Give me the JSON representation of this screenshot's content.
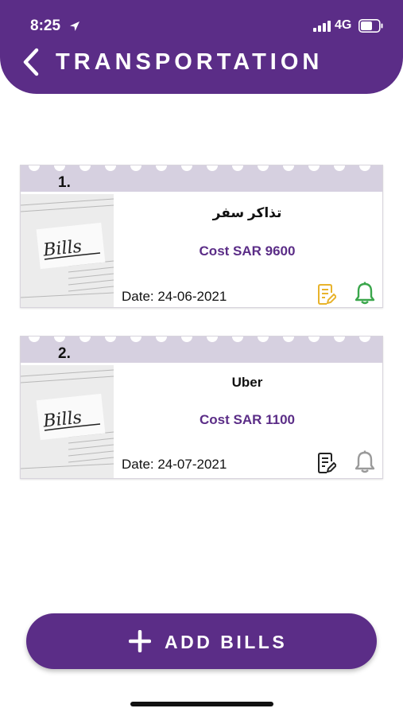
{
  "status": {
    "time": "8:25",
    "network": "4G"
  },
  "header": {
    "title": "TRANSPORTATION"
  },
  "bills": [
    {
      "number": "1.",
      "name": "تذاكر سفر",
      "cost": "Cost SAR 9600",
      "date": "Date: 24-06-2021",
      "image_text": "Bills",
      "edit_color": "#e8b32c",
      "bell_color": "#3aa64b"
    },
    {
      "number": "2.",
      "name": "Uber",
      "cost": "Cost SAR 1100",
      "date": "Date: 24-07-2021",
      "image_text": "Bills",
      "edit_color": "#222222",
      "bell_color": "#9a9a9a"
    }
  ],
  "footer": {
    "add_label": "ADD BILLS"
  },
  "colors": {
    "brand": "#5b2d87",
    "ticket_band": "#d6d0e0"
  }
}
